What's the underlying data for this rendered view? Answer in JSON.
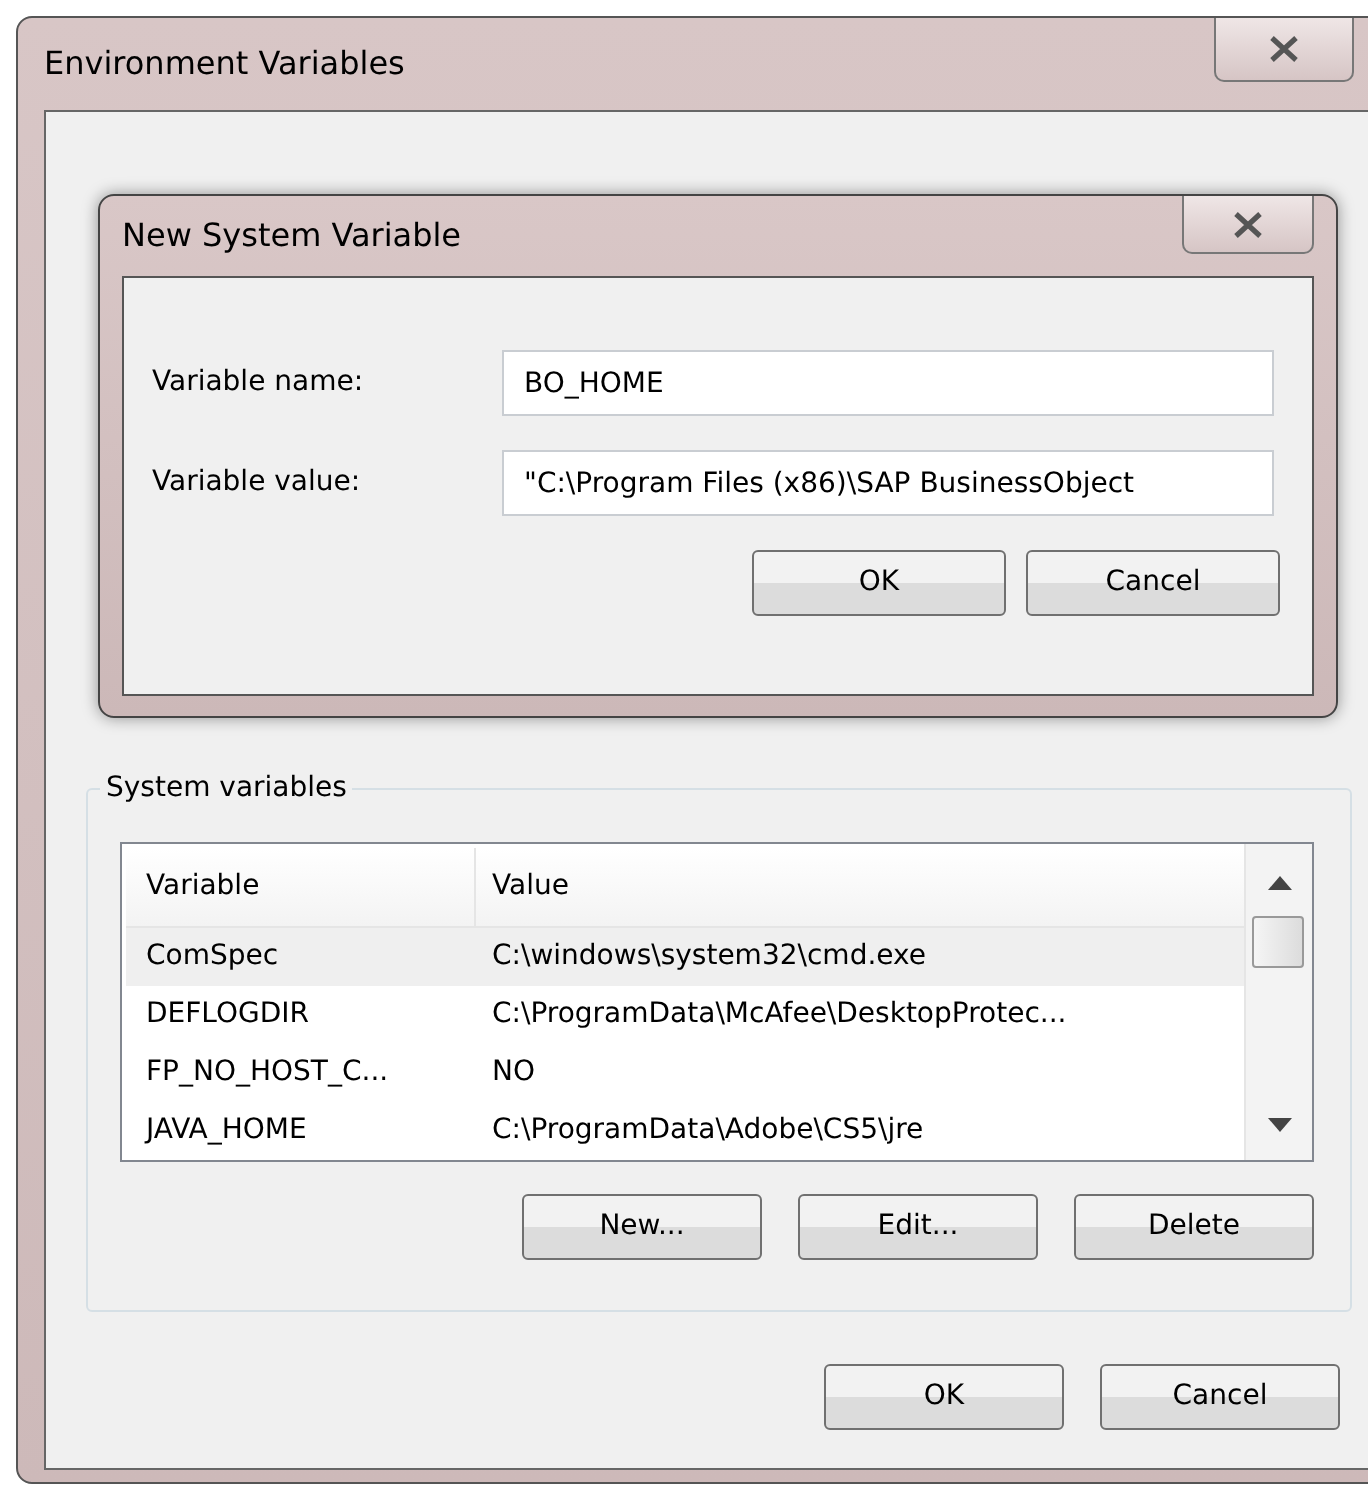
{
  "window": {
    "title": "Environment Variables"
  },
  "dialog": {
    "title": "New System Variable",
    "fields": [
      {
        "label": "Variable name:",
        "value": "BO_HOME"
      },
      {
        "label": "Variable value:",
        "value": "\"C:\\Program Files (x86)\\SAP BusinessObject"
      }
    ],
    "buttons": [
      "OK",
      "Cancel"
    ]
  },
  "system_variables": {
    "title": "System variables",
    "columns": [
      "Variable",
      "Value"
    ],
    "rows": [
      {
        "cells": [
          "ComSpec",
          "C:\\windows\\system32\\cmd.exe"
        ],
        "selected": true
      },
      {
        "cells": [
          "DEFLOGDIR",
          "C:\\ProgramData\\McAfee\\DesktopProtec..."
        ],
        "selected": false
      },
      {
        "cells": [
          "FP_NO_HOST_C...",
          "NO"
        ],
        "selected": false
      },
      {
        "cells": [
          "JAVA_HOME",
          "C:\\ProgramData\\Adobe\\CS5\\jre"
        ],
        "selected": false
      }
    ],
    "buttons": [
      "New...",
      "Edit...",
      "Delete"
    ]
  },
  "buttons": [
    "OK",
    "Cancel"
  ]
}
